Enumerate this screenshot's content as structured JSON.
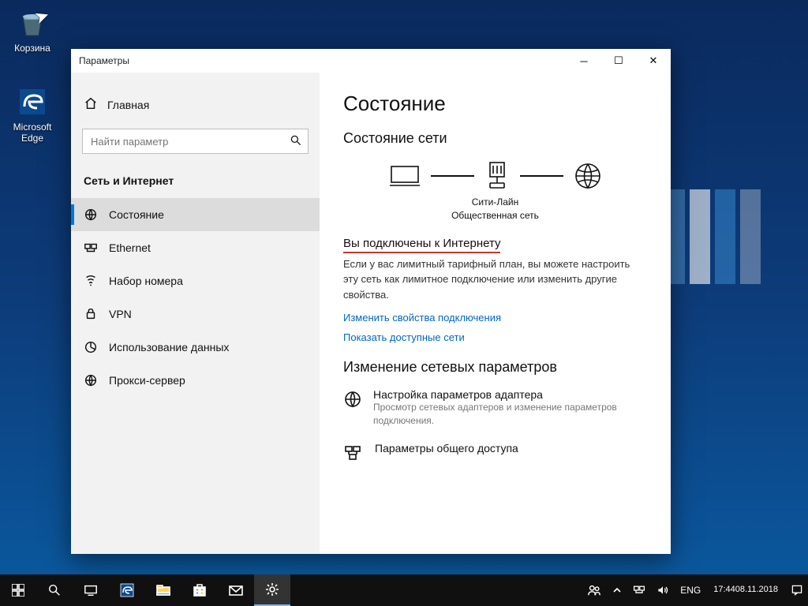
{
  "desktop": {
    "recycle_bin_label": "Корзина",
    "edge_label": "Microsoft Edge"
  },
  "window": {
    "title": "Параметры",
    "home": "Главная",
    "search_placeholder": "Найти параметр",
    "section": "Сеть и Интернет",
    "nav": {
      "status": "Состояние",
      "ethernet": "Ethernet",
      "dialup": "Набор номера",
      "vpn": "VPN",
      "data_usage": "Использование данных",
      "proxy": "Прокси-сервер"
    },
    "content": {
      "heading": "Состояние",
      "subheading": "Состояние сети",
      "network_name": "Сити-Лайн",
      "network_type": "Общественная сеть",
      "connected_title": "Вы подключены к Интернету",
      "connected_body": "Если у вас лимитный тарифный план, вы можете настроить эту сеть как лимитное подключение или изменить другие свойства.",
      "link_props": "Изменить свойства подключения",
      "link_networks": "Показать доступные сети",
      "change_settings_heading": "Изменение сетевых параметров",
      "adapter_title": "Настройка параметров адаптера",
      "adapter_desc": "Просмотр сетевых адаптеров и изменение параметров подключения.",
      "sharing_title": "Параметры общего доступа"
    }
  },
  "taskbar": {
    "lang": "ENG",
    "time": "17:44",
    "date": "08.11.2018"
  }
}
